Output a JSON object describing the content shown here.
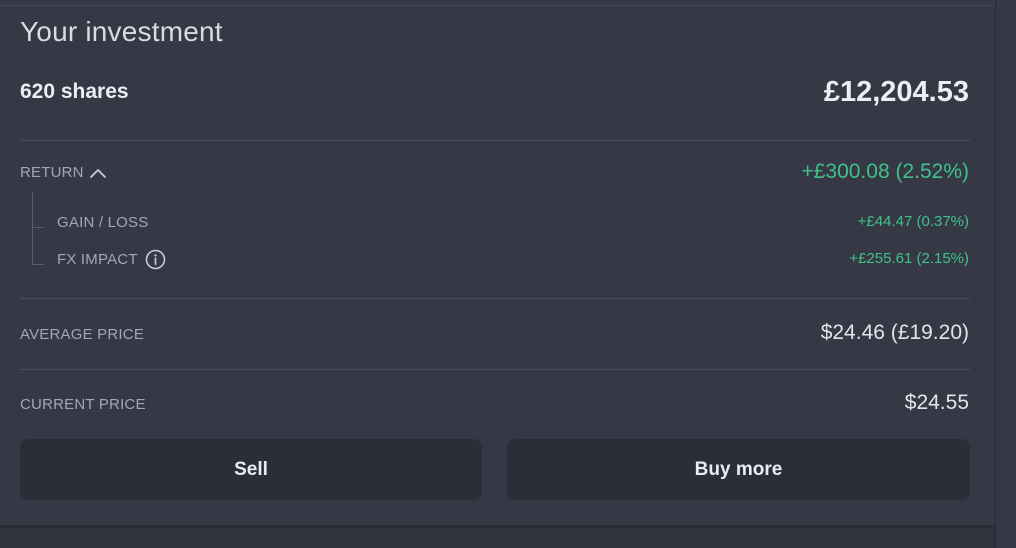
{
  "investment": {
    "title": "Your investment",
    "shares": "620 shares",
    "total_value": "£12,204.53"
  },
  "return": {
    "label": "RETURN",
    "value": "+£300.08 (2.52%)",
    "expanded": true,
    "toggle_icon": "chevron-up-icon",
    "breakdown": {
      "gain_loss": {
        "label": "GAIN / LOSS",
        "value": "+£44.47 (0.37%)"
      },
      "fx_impact": {
        "label": "FX IMPACT",
        "value": "+£255.61 (2.15%)",
        "info_icon": "info-icon"
      }
    }
  },
  "average_price": {
    "label": "AVERAGE PRICE",
    "value": "$24.46 (£19.20)"
  },
  "current_price": {
    "label": "CURRENT PRICE",
    "value": "$24.55"
  },
  "actions": {
    "sell_label": "Sell",
    "buy_label": "Buy more"
  },
  "colors": {
    "background": "#363845",
    "positive": "#3ec28a",
    "button": "#2b2d39"
  }
}
